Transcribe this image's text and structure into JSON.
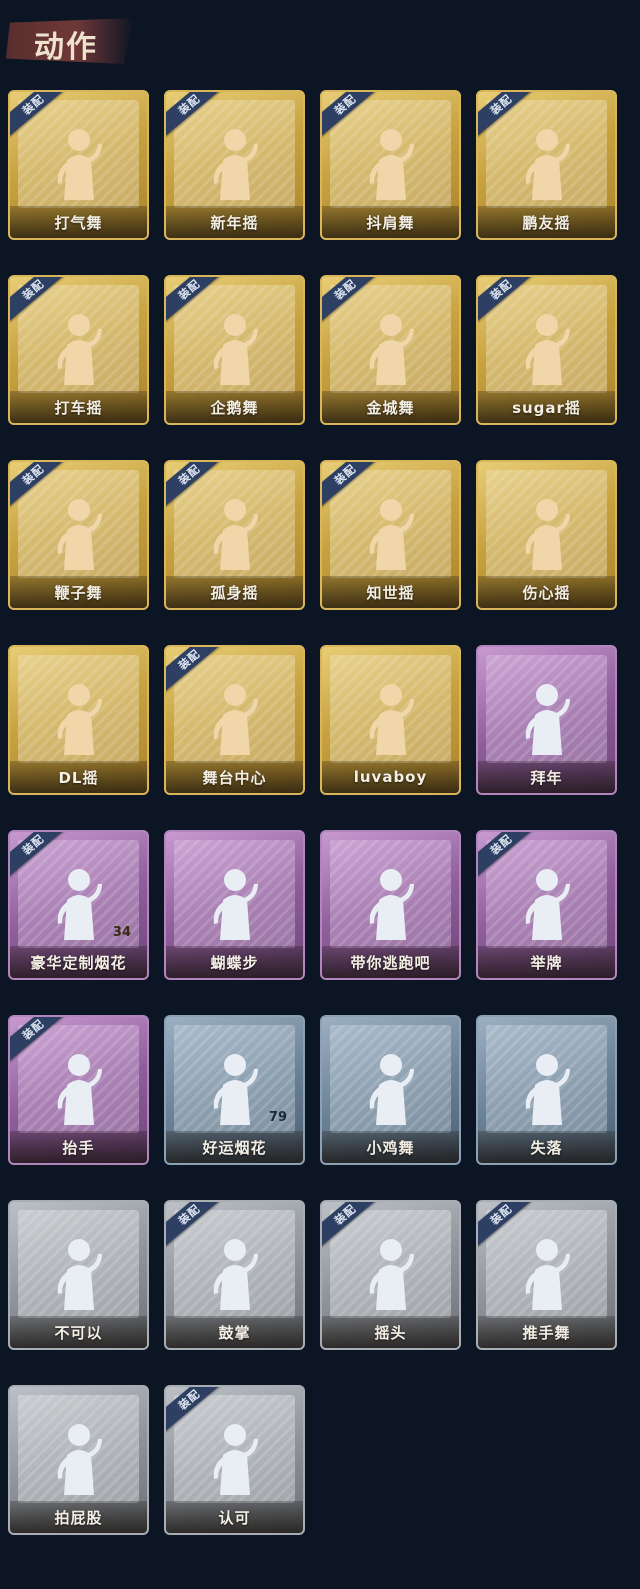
{
  "section": {
    "title": "动作"
  },
  "colors": {
    "gold": "#c7a23f",
    "purple": "#8f5e9b",
    "blue": "#6c8296",
    "grey": "#8f949b",
    "figure_gold": "#f0d6a8",
    "figure_light": "#e9eef5"
  },
  "badge_label": "装配",
  "cards": [
    {
      "label": "打气舞",
      "tier": "gold",
      "equipped": true,
      "icon": "dance-figure-icon"
    },
    {
      "label": "新年摇",
      "tier": "gold",
      "equipped": true,
      "icon": "dance-figure-icon"
    },
    {
      "label": "抖肩舞",
      "tier": "gold",
      "equipped": true,
      "icon": "dance-figure-icon"
    },
    {
      "label": "鹏友摇",
      "tier": "gold",
      "equipped": true,
      "icon": "dance-figure-icon"
    },
    {
      "label": "打车摇",
      "tier": "gold",
      "equipped": true,
      "icon": "dance-figure-icon"
    },
    {
      "label": "企鹅舞",
      "tier": "gold",
      "equipped": true,
      "icon": "dance-figure-icon"
    },
    {
      "label": "金城舞",
      "tier": "gold",
      "equipped": true,
      "icon": "dance-figure-icon"
    },
    {
      "label": "sugar摇",
      "tier": "gold",
      "equipped": true,
      "icon": "dance-figure-icon"
    },
    {
      "label": "鞭子舞",
      "tier": "gold",
      "equipped": true,
      "icon": "dance-figure-icon"
    },
    {
      "label": "孤身摇",
      "tier": "gold",
      "equipped": true,
      "icon": "dance-figure-icon"
    },
    {
      "label": "知世摇",
      "tier": "gold",
      "equipped": true,
      "icon": "dance-figure-icon"
    },
    {
      "label": "伤心摇",
      "tier": "gold",
      "equipped": false,
      "icon": "heart-hands-figure-icon"
    },
    {
      "label": "DL摇",
      "tier": "gold",
      "equipped": false,
      "icon": "dance-figure-icon"
    },
    {
      "label": "舞台中心",
      "tier": "gold",
      "equipped": true,
      "icon": "dance-figure-icon"
    },
    {
      "label": "luvaboy",
      "tier": "gold",
      "equipped": false,
      "icon": "dance-figure-icon"
    },
    {
      "label": "拜年",
      "tier": "purple",
      "equipped": false,
      "icon": "bow-figure-icon"
    },
    {
      "label": "豪华定制烟花",
      "tier": "purple",
      "equipped": true,
      "icon": "fireworks-box-icon",
      "count": "34"
    },
    {
      "label": "蝴蝶步",
      "tier": "purple",
      "equipped": false,
      "icon": "dance-figure-icon"
    },
    {
      "label": "带你逃跑吧",
      "tier": "purple",
      "equipped": false,
      "icon": "dance-figure-icon"
    },
    {
      "label": "举牌",
      "tier": "purple",
      "equipped": true,
      "icon": "sign-figure-icon"
    },
    {
      "label": "抬手",
      "tier": "purple",
      "equipped": true,
      "icon": "raise-hand-figure-icon"
    },
    {
      "label": "好运烟花",
      "tier": "blue",
      "equipped": false,
      "icon": "firework-can-icon",
      "count": "79"
    },
    {
      "label": "小鸡舞",
      "tier": "blue",
      "equipped": false,
      "icon": "chicken-dance-figure-icon"
    },
    {
      "label": "失落",
      "tier": "blue",
      "equipped": false,
      "icon": "kneeling-figure-icon"
    },
    {
      "label": "不可以",
      "tier": "grey",
      "equipped": false,
      "icon": "finger-wag-icon"
    },
    {
      "label": "鼓掌",
      "tier": "grey",
      "equipped": true,
      "icon": "clapping-hands-icon"
    },
    {
      "label": "摇头",
      "tier": "grey",
      "equipped": true,
      "icon": "head-shake-figure-icon"
    },
    {
      "label": "推手舞",
      "tier": "grey",
      "equipped": true,
      "icon": "push-hands-figure-icon"
    },
    {
      "label": "拍屁股",
      "tier": "grey",
      "equipped": false,
      "icon": "butt-slap-figure-icon"
    },
    {
      "label": "认可",
      "tier": "grey",
      "equipped": true,
      "icon": "thumbs-up-icon"
    }
  ]
}
